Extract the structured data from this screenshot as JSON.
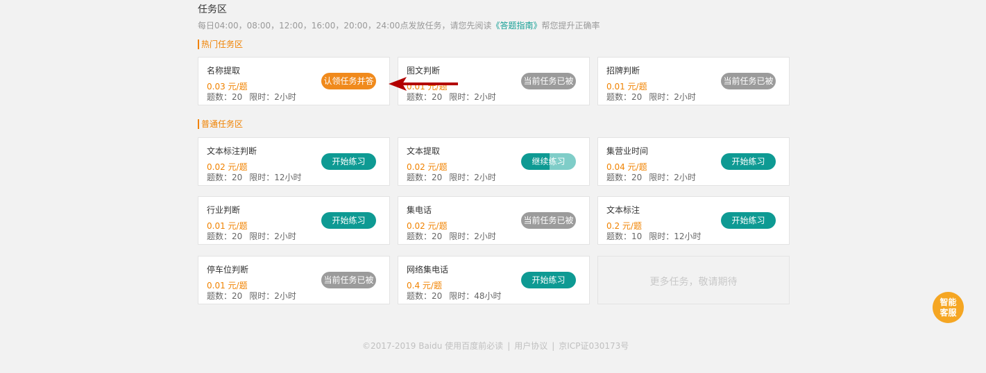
{
  "header": {
    "title": "任务区",
    "subtitle_prefix": "每日04:00，08:00，12:00，16:00，20:00，24:00点发放任务，请您先阅读",
    "guide_link": "《答题指南》",
    "subtitle_suffix": "帮您提升正确率"
  },
  "sections": {
    "hot_label": "热门任务区",
    "normal_label": "普通任务区"
  },
  "hot_cards": [
    {
      "name": "名称提取",
      "price": "0.03 元/题",
      "count": "题数：20",
      "limit": "限时：2小时",
      "button": "认领任务并答"
    },
    {
      "name": "图文判断",
      "price": "0.01 元/题",
      "count": "题数：20",
      "limit": "限时：2小时",
      "button": "当前任务已被"
    },
    {
      "name": "招牌判断",
      "price": "0.01 元/题",
      "count": "题数：20",
      "limit": "限时：2小时",
      "button": "当前任务已被"
    }
  ],
  "normal_cards": [
    {
      "name": "文本标注判断",
      "price": "0.02 元/题",
      "count": "题数：20",
      "limit": "限时：12小时",
      "button": "开始练习"
    },
    {
      "name": "文本提取",
      "price": "0.02 元/题",
      "count": "题数：20",
      "limit": "限时：2小时",
      "button": "继续练习"
    },
    {
      "name": "集营业时间",
      "price": "0.04 元/题",
      "count": "题数：20",
      "limit": "限时：2小时",
      "button": "开始练习"
    },
    {
      "name": "行业判断",
      "price": "0.01 元/题",
      "count": "题数：20",
      "limit": "限时：2小时",
      "button": "开始练习"
    },
    {
      "name": "集电话",
      "price": "0.02 元/题",
      "count": "题数：20",
      "limit": "限时：2小时",
      "button": "当前任务已被"
    },
    {
      "name": "文本标注",
      "price": "0.2 元/题",
      "count": "题数：10",
      "limit": "限时：12小时",
      "button": "开始练习"
    },
    {
      "name": "停车位判断",
      "price": "0.01 元/题",
      "count": "题数：20",
      "limit": "限时：2小时",
      "button": "当前任务已被"
    },
    {
      "name": "网络集电话",
      "price": "0.4 元/题",
      "count": "题数：20",
      "limit": "限时：48小时",
      "button": "开始练习"
    }
  ],
  "more_text": "更多任务，敬请期待",
  "footer": {
    "copyright": "©2017-2019 Baidu 使用百度前必读",
    "sep": "|",
    "agreement": "用户协议",
    "icp": "京ICP证030173号"
  },
  "service": {
    "line1": "智能",
    "line2": "客服"
  },
  "colors": {
    "accent_orange": "#f08a1c",
    "teal": "#0e9a93",
    "disabled_gray": "#9b9b9b",
    "annotation_arrow": "#b30000"
  }
}
